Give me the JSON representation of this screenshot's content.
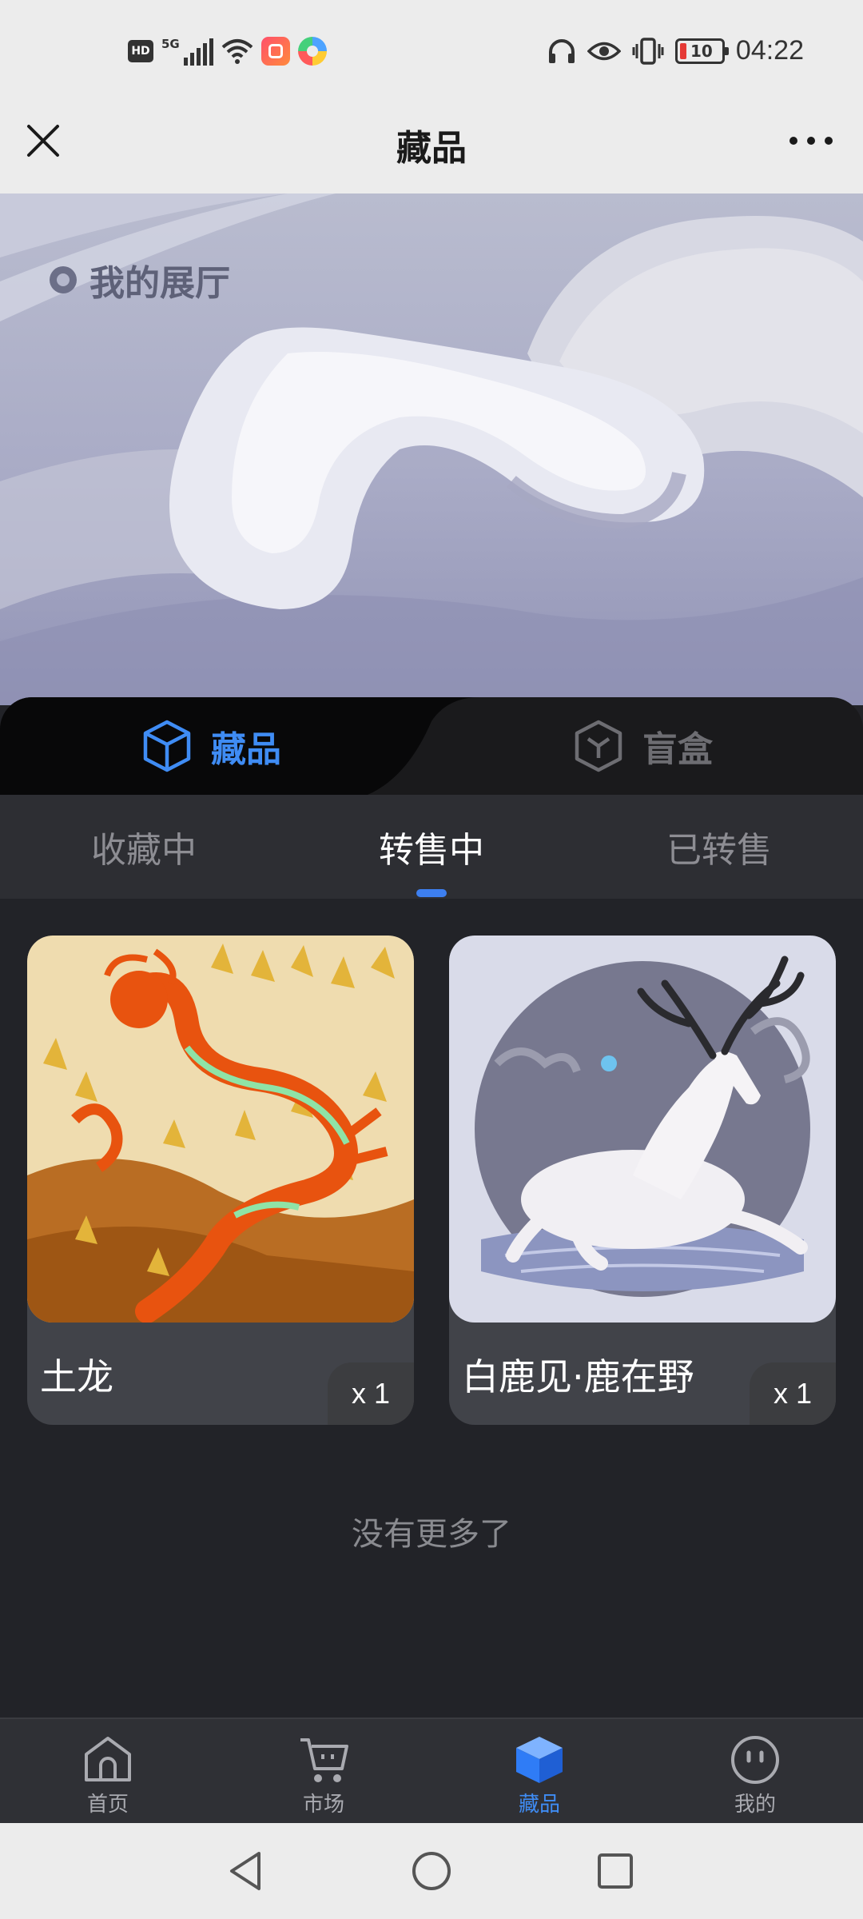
{
  "status_bar": {
    "hd": "HD",
    "network": "5G",
    "battery": "10",
    "time": "04:22",
    "icons": [
      "hd-icon",
      "signal-5g-icon",
      "wifi-icon",
      "app-notification-icon",
      "app-notification-icon",
      "headphones-icon",
      "eye-comfort-icon",
      "vibrate-icon",
      "battery-icon"
    ]
  },
  "header": {
    "title": "藏品",
    "close_icon": "close-icon",
    "more_icon": "more-icon"
  },
  "hero": {
    "label": "我的展厅"
  },
  "main_tabs": [
    {
      "label": "藏品",
      "icon": "cube-icon",
      "active": true
    },
    {
      "label": "盲盒",
      "icon": "box-icon",
      "active": false
    }
  ],
  "sub_tabs": [
    {
      "label": "收藏中",
      "active": false
    },
    {
      "label": "转售中",
      "active": true
    },
    {
      "label": "已转售",
      "active": false
    }
  ],
  "items": [
    {
      "name": "土龙",
      "quantity": "x 1",
      "image": "dragon-pixel-art"
    },
    {
      "name": "白鹿见·鹿在野",
      "quantity": "x 1",
      "image": "white-deer-art"
    }
  ],
  "no_more_text": "没有更多了",
  "bottom_nav": [
    {
      "label": "首页",
      "icon": "home-icon",
      "active": false
    },
    {
      "label": "市场",
      "icon": "cart-icon",
      "active": false
    },
    {
      "label": "藏品",
      "icon": "collection-box-icon",
      "active": true
    },
    {
      "label": "我的",
      "icon": "profile-icon",
      "active": false
    }
  ],
  "colors": {
    "accent": "#3f8cf4",
    "background": "#222328",
    "header_bg": "#ececec"
  }
}
